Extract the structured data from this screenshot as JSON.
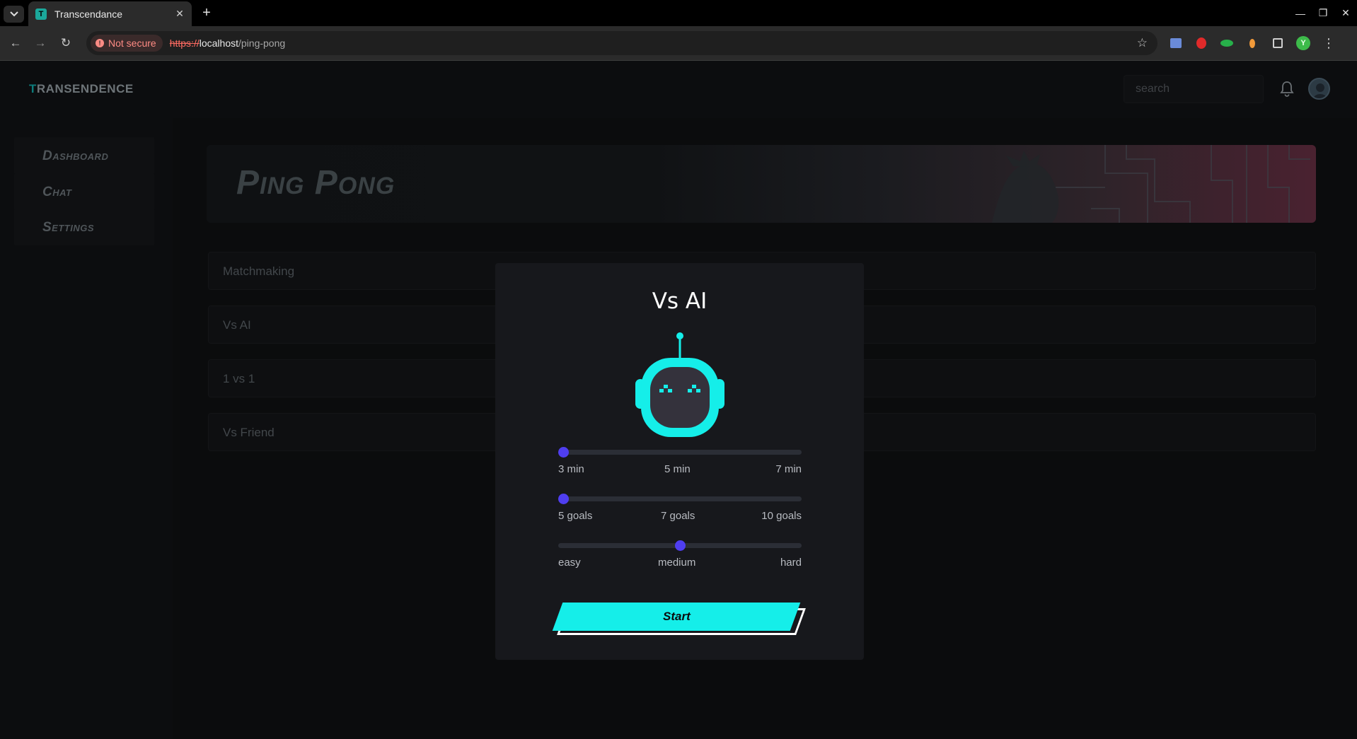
{
  "browser": {
    "tab_title": "Transcendance",
    "tab_favicon_letter": "T",
    "security_label": "Not secure",
    "url_scheme": "https://",
    "url_host": "localhost",
    "url_path": "/ping-pong",
    "profile_initial": "Y"
  },
  "app": {
    "logo_first": "T",
    "logo_rest": "RANSENDENCE",
    "search_placeholder": "search",
    "sidebar": [
      "Dashboard",
      "Chat",
      "Settings"
    ],
    "page_title": "Ping Pong",
    "modes": [
      "Matchmaking",
      "Vs AI",
      "1 vs 1",
      "Vs Friend"
    ]
  },
  "modal": {
    "title": "Vs AI",
    "duration": {
      "labels": [
        "3 min",
        "5 min",
        "7 min"
      ],
      "selected": "3 min",
      "value_fraction": 0.0
    },
    "goals": {
      "labels": [
        "5 goals",
        "7 goals",
        "10 goals"
      ],
      "selected": "5 goals",
      "value_fraction": 0.0
    },
    "difficulty": {
      "labels": [
        "easy",
        "medium",
        "hard"
      ],
      "selected": "medium",
      "value_fraction": 0.5
    },
    "start_label": "Start"
  },
  "colors": {
    "accent_cyan": "#15eee9",
    "slider_thumb": "#4f3ef0",
    "modal_bg": "#17181c",
    "app_bg": "#0b0c0d"
  }
}
